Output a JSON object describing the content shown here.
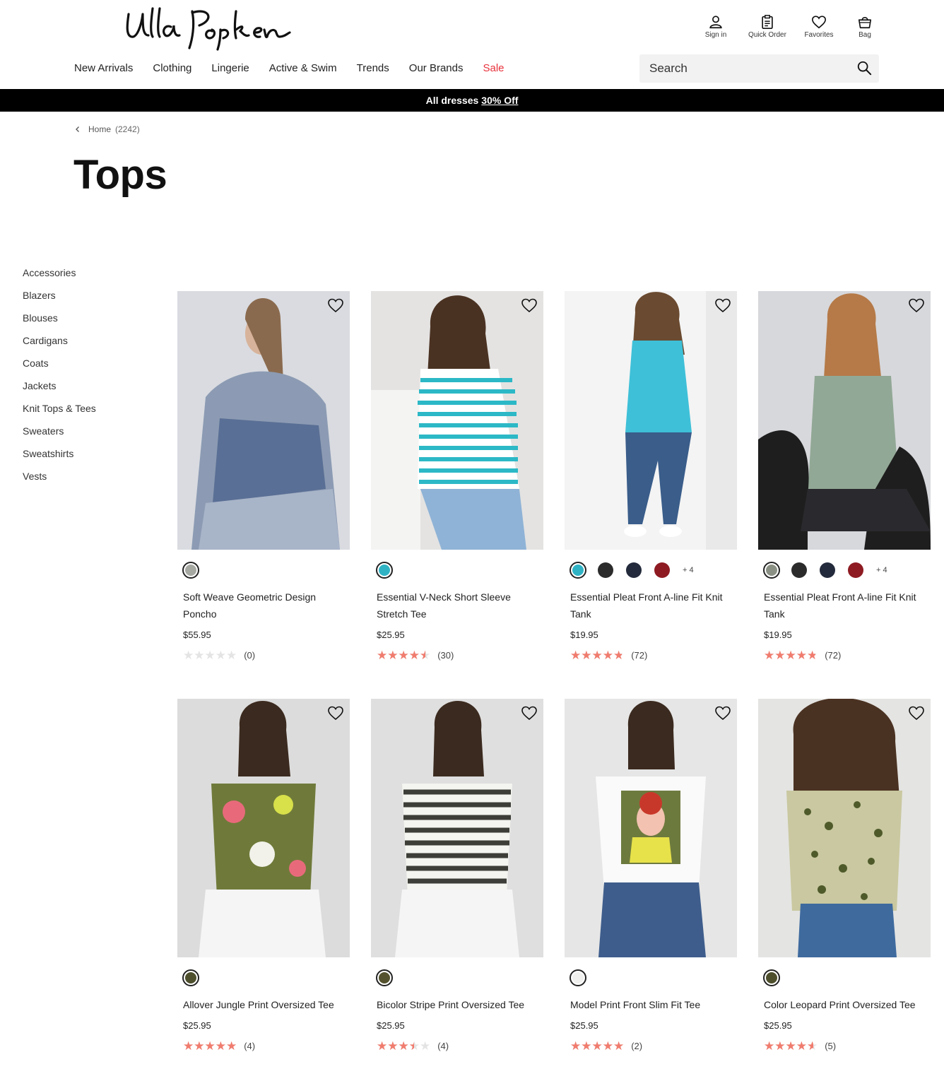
{
  "brand": {
    "logo_text": "Ulla Popken"
  },
  "utility": [
    {
      "label": "Sign in",
      "icon": "user-icon"
    },
    {
      "label": "Quick Order",
      "icon": "clipboard-icon"
    },
    {
      "label": "Favorites",
      "icon": "heart-icon"
    },
    {
      "label": "Bag",
      "icon": "bag-icon"
    }
  ],
  "nav": [
    "New Arrivals",
    "Clothing",
    "Lingerie",
    "Active & Swim",
    "Trends",
    "Our Brands",
    "Sale"
  ],
  "search": {
    "placeholder": "Search"
  },
  "promo": {
    "text": "All dresses",
    "link": "30% Off"
  },
  "breadcrumb": {
    "label": "Home",
    "count": "(2242)"
  },
  "page_title": "Tops",
  "sidebar": [
    "Accessories",
    "Blazers",
    "Blouses",
    "Cardigans",
    "Coats",
    "Jackets",
    "Knit Tops & Tees",
    "Sweaters",
    "Sweatshirts",
    "Vests"
  ],
  "colors": {
    "accent_star": "#f07c6e",
    "sale": "#e8323c"
  },
  "products": [
    {
      "name": "Soft Weave Geometric Design Poncho",
      "price": "$55.95",
      "rating": 0,
      "reviews": "(0)",
      "swatches": [
        "#a6a8a2"
      ],
      "more": ""
    },
    {
      "name": "Essential V-Neck Short Sleeve Stretch Tee",
      "price": "$25.95",
      "rating": 4.5,
      "reviews": "(30)",
      "swatches": [
        "#2fb3c4"
      ],
      "more": ""
    },
    {
      "name": "Essential Pleat Front A-line Fit Knit Tank",
      "price": "$19.95",
      "rating": 4.8,
      "reviews": "(72)",
      "swatches": [
        "#2fb3c4",
        "#2b2b2b",
        "#232a3b",
        "#8e1b22"
      ],
      "more": "+ 4"
    },
    {
      "name": "Essential Pleat Front A-line Fit Knit Tank",
      "price": "$19.95",
      "rating": 4.8,
      "reviews": "(72)",
      "swatches": [
        "#8a9184",
        "#2b2b2b",
        "#232a3b",
        "#8e1b22"
      ],
      "more": "+ 4"
    },
    {
      "name": "Allover Jungle Print Oversized Tee",
      "price": "$25.95",
      "rating": 5,
      "reviews": "(4)",
      "swatches": [
        "#4e4f2c"
      ],
      "more": ""
    },
    {
      "name": "Bicolor Stripe Print Oversized Tee",
      "price": "$25.95",
      "rating": 3.5,
      "reviews": "(4)",
      "swatches": [
        "#55532f"
      ],
      "more": ""
    },
    {
      "name": "Model Print Front Slim Fit Tee",
      "price": "$25.95",
      "rating": 5,
      "reviews": "(2)",
      "swatches": [
        "#f0f0ee"
      ],
      "more": ""
    },
    {
      "name": "Color Leopard Print Oversized Tee",
      "price": "$25.95",
      "rating": 4.6,
      "reviews": "(5)",
      "swatches": [
        "#4e4f2c"
      ],
      "more": ""
    }
  ]
}
